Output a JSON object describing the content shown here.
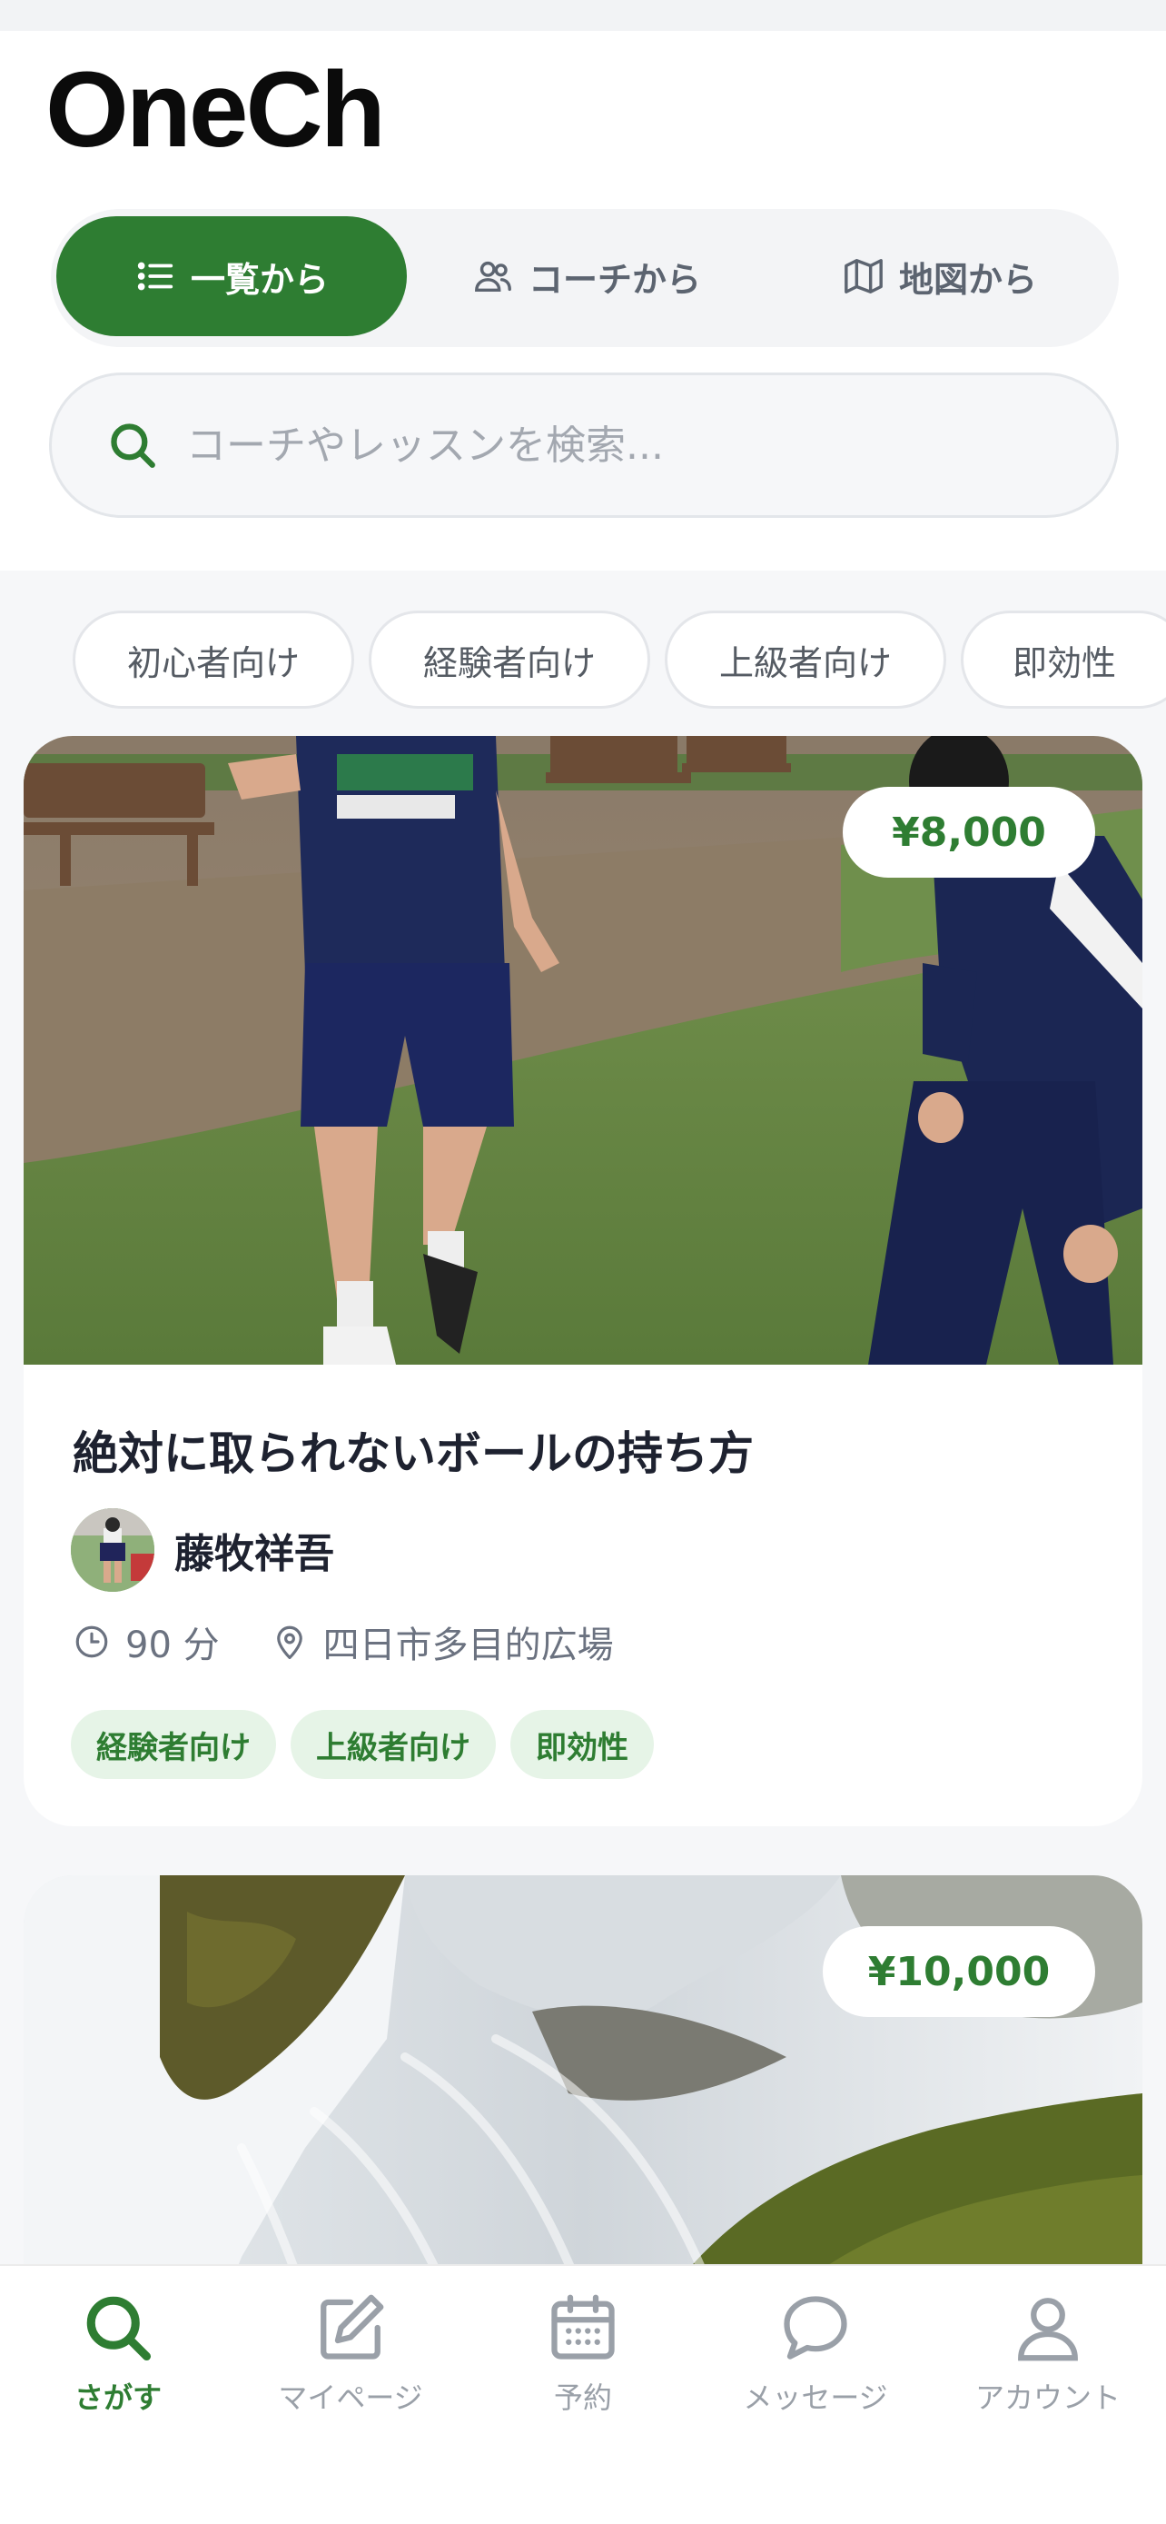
{
  "app": {
    "logo": "OneCh"
  },
  "view_tabs": [
    {
      "label": "一覧から",
      "icon": "list-icon",
      "active": true
    },
    {
      "label": "コーチから",
      "icon": "users-icon",
      "active": false
    },
    {
      "label": "地図から",
      "icon": "map-icon",
      "active": false
    }
  ],
  "search": {
    "placeholder": "コーチやレッスンを検索..."
  },
  "filters": [
    "初心者向け",
    "経験者向け",
    "上級者向け",
    "即効性"
  ],
  "cards": [
    {
      "price": "¥8,000",
      "title": "絶対に取られないボールの持ち方",
      "coach": "藤牧祥吾",
      "duration": "90 分",
      "location": "四日市多目的広場",
      "tags": [
        "経験者向け",
        "上級者向け",
        "即効性"
      ]
    },
    {
      "price": "¥10,000"
    }
  ],
  "bottom_nav": [
    {
      "label": "さがす",
      "icon": "search-icon",
      "active": true
    },
    {
      "label": "マイページ",
      "icon": "edit-icon",
      "active": false
    },
    {
      "label": "予約",
      "icon": "calendar-icon",
      "active": false
    },
    {
      "label": "メッセージ",
      "icon": "message-icon",
      "active": false
    },
    {
      "label": "アカウント",
      "icon": "person-icon",
      "active": false
    }
  ],
  "colors": {
    "accent": "#2e7d32",
    "tag_bg": "#e6f4e7",
    "muted": "#9aa0a8"
  }
}
